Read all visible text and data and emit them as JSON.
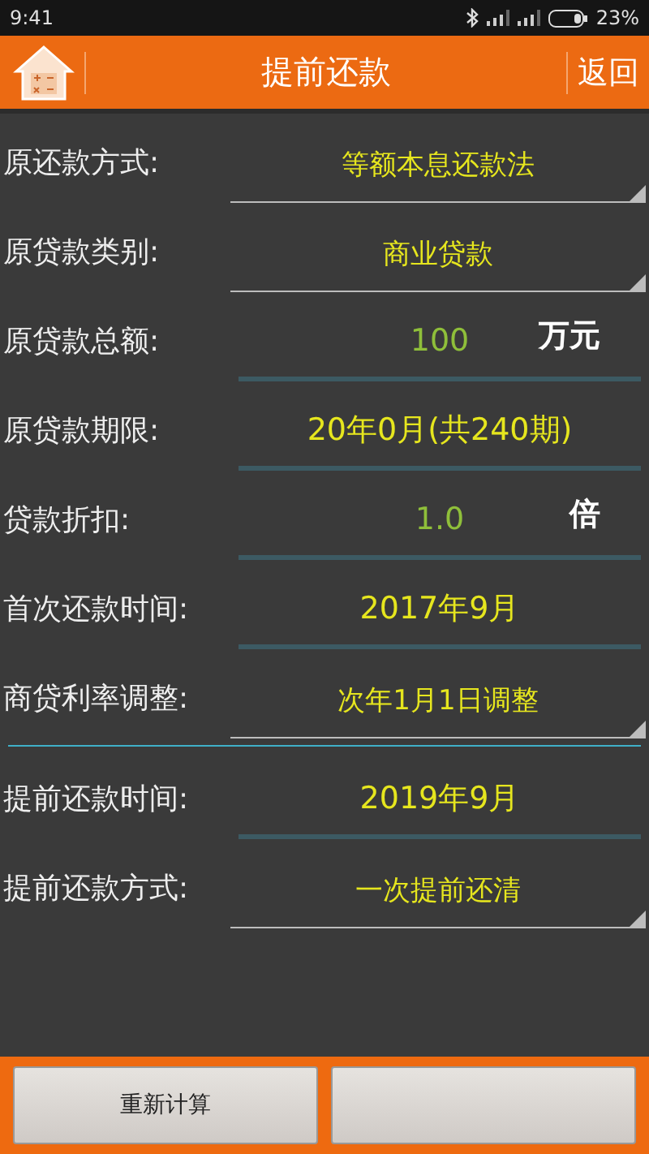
{
  "status_bar": {
    "time": "9:41",
    "battery": "23%"
  },
  "header": {
    "title": "提前还款",
    "back": "返回"
  },
  "loan_fields": [
    {
      "kind": "spinner",
      "label": "原还款方式:",
      "value": "等额本息还款法"
    },
    {
      "kind": "spinner",
      "label": "原贷款类别:",
      "value": "商业贷款"
    },
    {
      "kind": "input",
      "label": "原贷款总额:",
      "value": "100",
      "unit": "万元"
    },
    {
      "kind": "picker",
      "label": "原贷款期限:",
      "value": "20年0月(共240期)"
    },
    {
      "kind": "input",
      "label": "贷款折扣:",
      "value": "1.0",
      "unit": "倍"
    },
    {
      "kind": "picker",
      "label": "首次还款时间:",
      "value": "2017年9月"
    },
    {
      "kind": "spinner",
      "label": "商贷利率调整:",
      "value": "次年1月1日调整"
    }
  ],
  "prepay_fields": [
    {
      "kind": "picker",
      "label": "提前还款时间:",
      "value": "2019年9月"
    },
    {
      "kind": "spinner",
      "label": "提前还款方式:",
      "value": "一次提前还清"
    }
  ],
  "buttons": [
    {
      "kind": "text",
      "label": "重新计算"
    },
    {
      "kind": "blank"
    }
  ]
}
